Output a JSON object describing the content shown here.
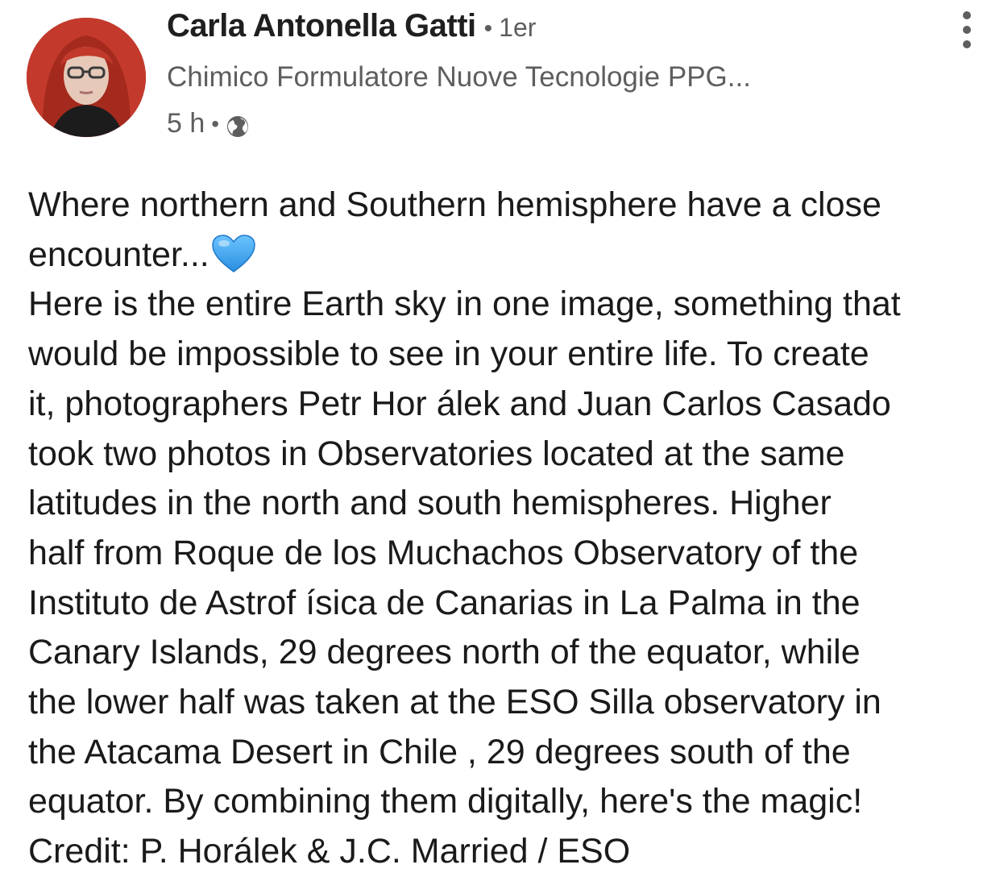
{
  "author": {
    "name": "Carla Antonella Gatti",
    "connection_degree": "1er",
    "headline": "Chimico Formulatore Nuove Tecnologie PPG...",
    "time_ago": "5 h",
    "visibility_icon": "globe-icon",
    "avatar_colors": {
      "background": "#b8322a",
      "hair": "#c0392b",
      "skin": "#e6c9b8",
      "clothing": "#1c1c1c"
    }
  },
  "menu_icon": "more-vertical-icon",
  "post": {
    "lines": [
      "Where northern and Southern hemisphere have a close",
      "encounter...",
      "Here is the entire Earth sky in one image, something that",
      "would be impossible to see in your entire life. To create",
      "it, photographers Petr Hor álek and Juan Carlos Casado",
      "took two photos in Observatories located at the same",
      "latitudes in the north and south hemispheres. Higher",
      "half from Roque de los Muchachos Observatory of the",
      "Instituto de Astrof ísica de Canarias in La Palma in the",
      "Canary Islands, 29 degrees north of the equator, while",
      "the lower half was taken at the ESO Silla observatory in",
      "the Atacama Desert in Chile , 29 degrees south of the",
      "equator. By combining them digitally, here's the magic!",
      "Credit: P. Horálek & J.C. Married / ESO"
    ],
    "emoji": "blue-heart-icon",
    "heart_color": "#3aa8f0"
  }
}
